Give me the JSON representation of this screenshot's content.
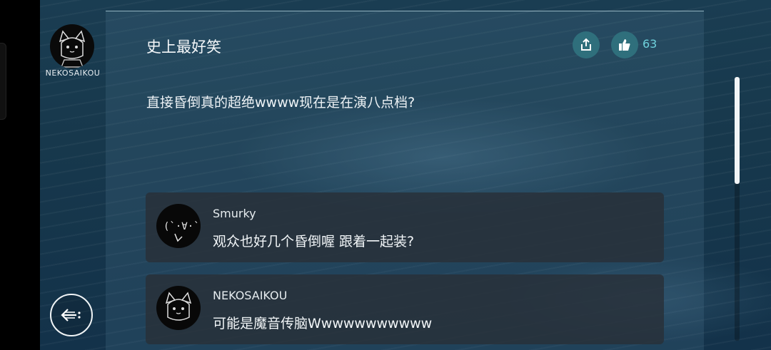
{
  "user": {
    "name": "NEKOSAIKOU",
    "avatar": "cat-ear-girl-avatar"
  },
  "post": {
    "title": "史上最好笑",
    "body": "直接昏倒真的超绝wwww现在是在演八点档?",
    "likes": "63"
  },
  "replies": [
    {
      "name": "Smurky",
      "text": "观众也好几个昏倒喔 跟着一起装?",
      "avatar": "thinking-face-avatar"
    },
    {
      "name": "NEKOSAIKOU",
      "text": "可能是魔音传脑Wwwwwwwwwww",
      "avatar": "cat-ear-girl-avatar"
    }
  ],
  "icons": {
    "share": "share-icon",
    "like": "thumbs-up-icon",
    "back": "back-arrow-icon"
  },
  "colors": {
    "accent": "#6fd1dc",
    "button": "#2f6f7c"
  }
}
